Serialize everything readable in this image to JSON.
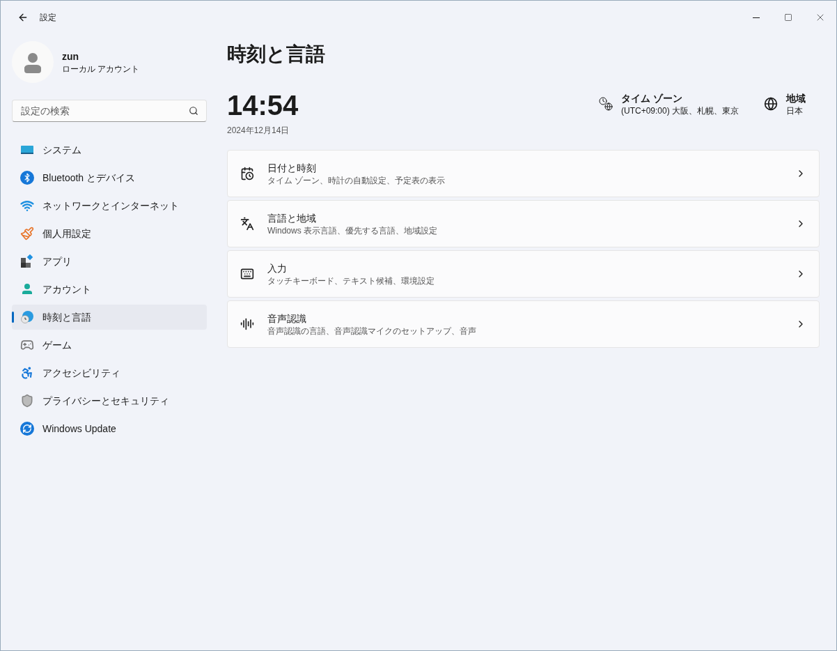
{
  "window": {
    "title": "設定"
  },
  "profile": {
    "name": "zun",
    "account_type": "ローカル アカウント"
  },
  "search": {
    "placeholder": "設定の検索"
  },
  "sidebar": {
    "items": [
      {
        "label": "システム",
        "selected": false
      },
      {
        "label": "Bluetooth とデバイス",
        "selected": false
      },
      {
        "label": "ネットワークとインターネット",
        "selected": false
      },
      {
        "label": "個人用設定",
        "selected": false
      },
      {
        "label": "アプリ",
        "selected": false
      },
      {
        "label": "アカウント",
        "selected": false
      },
      {
        "label": "時刻と言語",
        "selected": true
      },
      {
        "label": "ゲーム",
        "selected": false
      },
      {
        "label": "アクセシビリティ",
        "selected": false
      },
      {
        "label": "プライバシーとセキュリティ",
        "selected": false
      },
      {
        "label": "Windows Update",
        "selected": false
      }
    ]
  },
  "page": {
    "title": "時刻と言語",
    "time": "14:54",
    "date": "2024年12月14日",
    "info": [
      {
        "label": "タイム ゾーン",
        "value": "(UTC+09:00) 大阪、札幌、東京"
      },
      {
        "label": "地域",
        "value": "日本"
      }
    ],
    "cards": [
      {
        "title": "日付と時刻",
        "subtitle": "タイム ゾーン、時計の自動設定、予定表の表示"
      },
      {
        "title": "言語と地域",
        "subtitle": "Windows 表示言語、優先する言語、地域設定"
      },
      {
        "title": "入力",
        "subtitle": "タッチキーボード、テキスト候補、環境設定"
      },
      {
        "title": "音声認識",
        "subtitle": "音声認識の言語、音声認識マイクのセットアップ、音声"
      }
    ]
  }
}
